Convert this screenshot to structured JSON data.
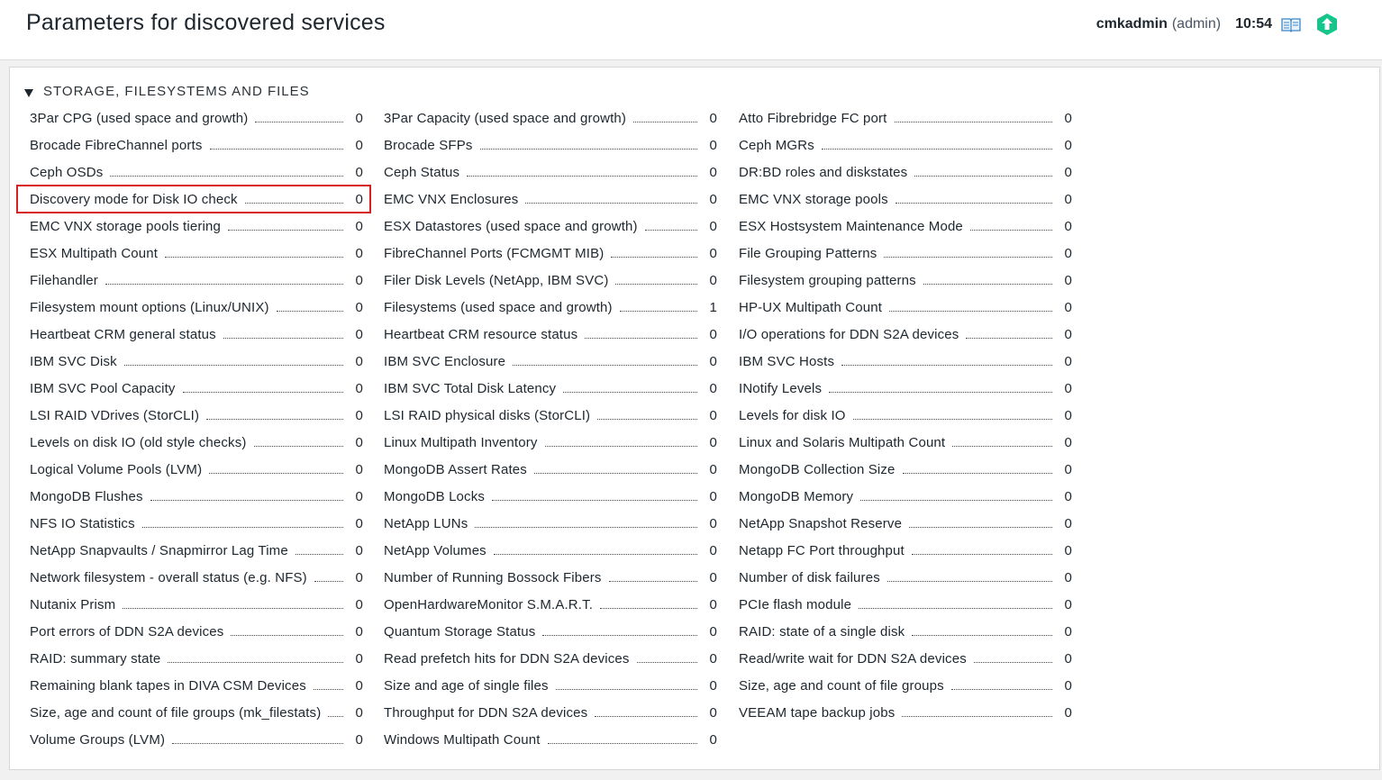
{
  "header": {
    "title": "Parameters for discovered services",
    "user_name": "cmkadmin",
    "user_role": "(admin)",
    "time": "10:54",
    "icons": [
      "book-icon",
      "status-icon"
    ]
  },
  "section": {
    "title": "STORAGE, FILESYSTEMS AND FILES",
    "highlighted_item": "Discovery mode for Disk IO check",
    "columns": [
      [
        {
          "label": "3Par CPG (used space and growth)",
          "count": "0"
        },
        {
          "label": "Brocade FibreChannel ports",
          "count": "0"
        },
        {
          "label": "Ceph OSDs",
          "count": "0"
        },
        {
          "label": "Discovery mode for Disk IO check",
          "count": "0"
        },
        {
          "label": "EMC VNX storage pools tiering",
          "count": "0"
        },
        {
          "label": "ESX Multipath Count",
          "count": "0"
        },
        {
          "label": "Filehandler",
          "count": "0"
        },
        {
          "label": "Filesystem mount options (Linux/UNIX)",
          "count": "0"
        },
        {
          "label": "Heartbeat CRM general status",
          "count": "0"
        },
        {
          "label": "IBM SVC Disk",
          "count": "0"
        },
        {
          "label": "IBM SVC Pool Capacity",
          "count": "0"
        },
        {
          "label": "LSI RAID VDrives (StorCLI)",
          "count": "0"
        },
        {
          "label": "Levels on disk IO (old style checks)",
          "count": "0"
        },
        {
          "label": "Logical Volume Pools (LVM)",
          "count": "0"
        },
        {
          "label": "MongoDB Flushes",
          "count": "0"
        },
        {
          "label": "NFS IO Statistics",
          "count": "0"
        },
        {
          "label": "NetApp Snapvaults / Snapmirror Lag Time",
          "count": "0"
        },
        {
          "label": "Network filesystem - overall status (e.g. NFS)",
          "count": "0"
        },
        {
          "label": "Nutanix Prism",
          "count": "0"
        },
        {
          "label": "Port errors of DDN S2A devices",
          "count": "0"
        },
        {
          "label": "RAID: summary state",
          "count": "0"
        },
        {
          "label": "Remaining blank tapes in DIVA CSM Devices",
          "count": "0"
        },
        {
          "label": "Size, age and count of file groups (mk_filestats)",
          "count": "0"
        },
        {
          "label": "Volume Groups (LVM)",
          "count": "0"
        }
      ],
      [
        {
          "label": "3Par Capacity (used space and growth)",
          "count": "0"
        },
        {
          "label": "Brocade SFPs",
          "count": "0"
        },
        {
          "label": "Ceph Status",
          "count": "0"
        },
        {
          "label": "EMC VNX Enclosures",
          "count": "0"
        },
        {
          "label": "ESX Datastores (used space and growth)",
          "count": "0"
        },
        {
          "label": "FibreChannel Ports (FCMGMT MIB)",
          "count": "0"
        },
        {
          "label": "Filer Disk Levels (NetApp, IBM SVC)",
          "count": "0"
        },
        {
          "label": "Filesystems (used space and growth)",
          "count": "1"
        },
        {
          "label": "Heartbeat CRM resource status",
          "count": "0"
        },
        {
          "label": "IBM SVC Enclosure",
          "count": "0"
        },
        {
          "label": "IBM SVC Total Disk Latency",
          "count": "0"
        },
        {
          "label": "LSI RAID physical disks (StorCLI)",
          "count": "0"
        },
        {
          "label": "Linux Multipath Inventory",
          "count": "0"
        },
        {
          "label": "MongoDB Assert Rates",
          "count": "0"
        },
        {
          "label": "MongoDB Locks",
          "count": "0"
        },
        {
          "label": "NetApp LUNs",
          "count": "0"
        },
        {
          "label": "NetApp Volumes",
          "count": "0"
        },
        {
          "label": "Number of Running Bossock Fibers",
          "count": "0"
        },
        {
          "label": "OpenHardwareMonitor S.M.A.R.T.",
          "count": "0"
        },
        {
          "label": "Quantum Storage Status",
          "count": "0"
        },
        {
          "label": "Read prefetch hits for DDN S2A devices",
          "count": "0"
        },
        {
          "label": "Size and age of single files",
          "count": "0"
        },
        {
          "label": "Throughput for DDN S2A devices",
          "count": "0"
        },
        {
          "label": "Windows Multipath Count",
          "count": "0"
        }
      ],
      [
        {
          "label": "Atto Fibrebridge FC port",
          "count": "0"
        },
        {
          "label": "Ceph MGRs",
          "count": "0"
        },
        {
          "label": "DR:BD roles and diskstates",
          "count": "0"
        },
        {
          "label": "EMC VNX storage pools",
          "count": "0"
        },
        {
          "label": "ESX Hostsystem Maintenance Mode",
          "count": "0"
        },
        {
          "label": "File Grouping Patterns",
          "count": "0"
        },
        {
          "label": "Filesystem grouping patterns",
          "count": "0"
        },
        {
          "label": "HP-UX Multipath Count",
          "count": "0"
        },
        {
          "label": "I/O operations for DDN S2A devices",
          "count": "0"
        },
        {
          "label": "IBM SVC Hosts",
          "count": "0"
        },
        {
          "label": "INotify Levels",
          "count": "0"
        },
        {
          "label": "Levels for disk IO",
          "count": "0"
        },
        {
          "label": "Linux and Solaris Multipath Count",
          "count": "0"
        },
        {
          "label": "MongoDB Collection Size",
          "count": "0"
        },
        {
          "label": "MongoDB Memory",
          "count": "0"
        },
        {
          "label": "NetApp Snapshot Reserve",
          "count": "0"
        },
        {
          "label": "Netapp FC Port throughput",
          "count": "0"
        },
        {
          "label": "Number of disk failures",
          "count": "0"
        },
        {
          "label": "PCIe flash module",
          "count": "0"
        },
        {
          "label": "RAID: state of a single disk",
          "count": "0"
        },
        {
          "label": "Read/write wait for DDN S2A devices",
          "count": "0"
        },
        {
          "label": "Size, age and count of file groups",
          "count": "0"
        },
        {
          "label": "VEEAM tape backup jobs",
          "count": "0"
        }
      ]
    ]
  }
}
